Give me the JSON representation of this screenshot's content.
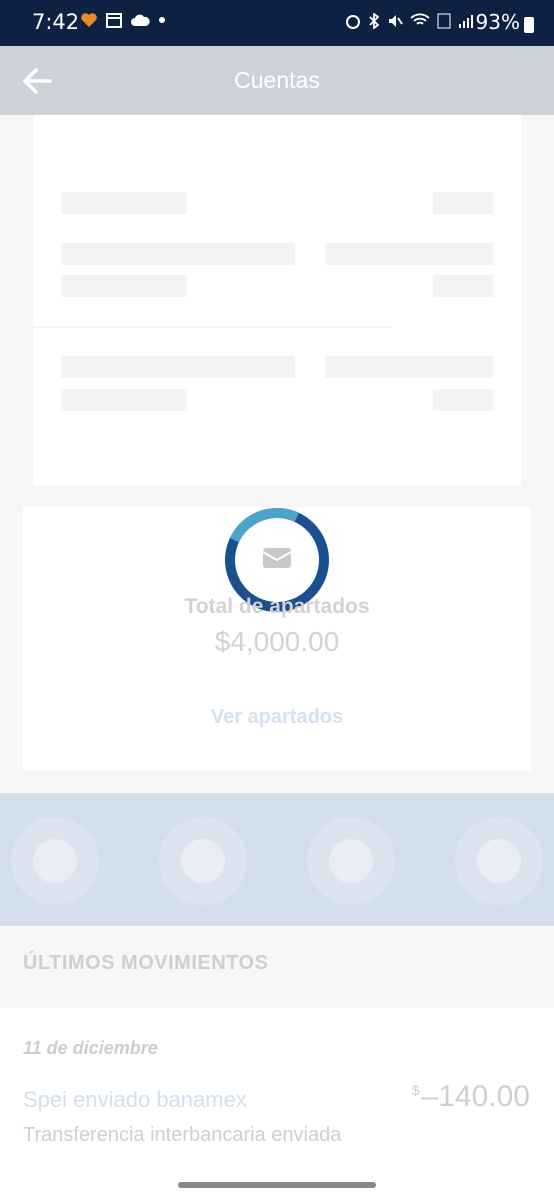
{
  "status_bar": {
    "time": "7:42",
    "battery": "93%",
    "icons": [
      "heart-icon",
      "calendar-icon",
      "cloud-icon",
      "dot-icon",
      "alarm-icon",
      "bluetooth-icon",
      "mute-icon",
      "wifi-icon",
      "volte-icon",
      "signal-icon",
      "battery-icon"
    ]
  },
  "header": {
    "title": "Cuentas",
    "back_icon": "arrow-left-icon"
  },
  "savings": {
    "label": "Total de apartados",
    "amount": "$4,000.00",
    "link": "Ver apartados",
    "icon": "envelope-icon"
  },
  "movements": {
    "title": "ÚLTIMOS MOVIMIENTOS",
    "date": "11 de diciembre",
    "items": [
      {
        "title": "Spei enviado banamex",
        "subtitle": "Transferencia interbancaria enviada",
        "currency": "$",
        "amount": "–140.00"
      }
    ]
  },
  "colors": {
    "status_bar": "#0e2143",
    "header": "#cdd2da",
    "loader": "#1c4f8e",
    "actions_band": "#d3deeb"
  }
}
